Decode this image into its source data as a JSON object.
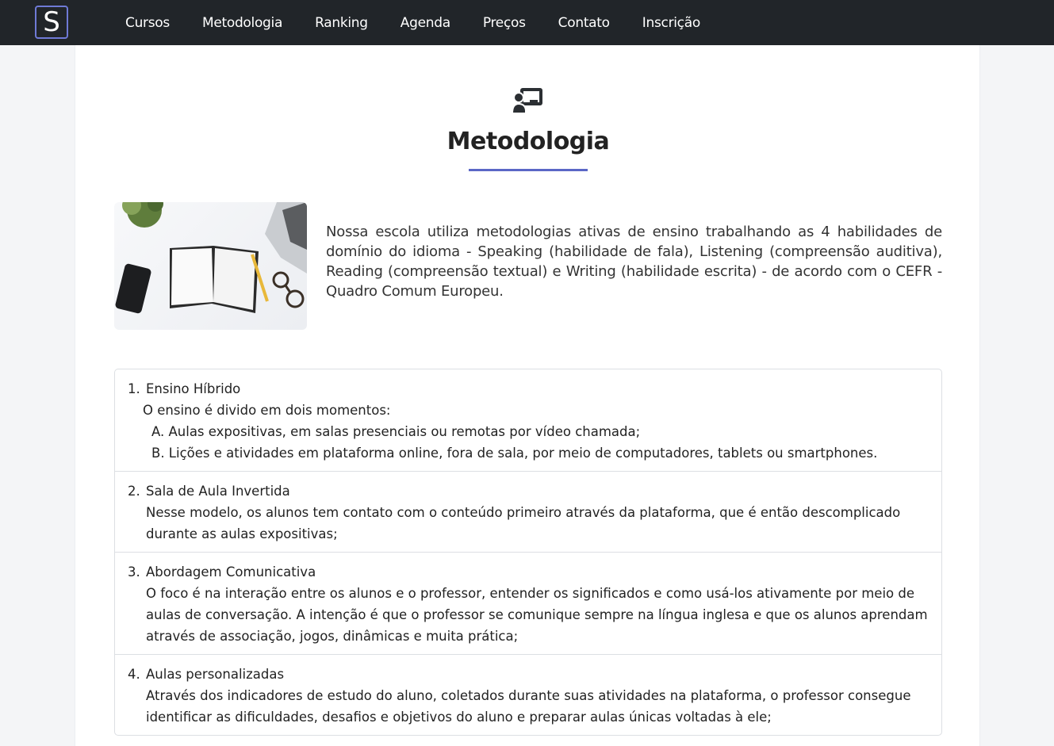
{
  "nav": {
    "logo": "S",
    "links": [
      "Cursos",
      "Metodologia",
      "Ranking",
      "Agenda",
      "Preços",
      "Contato",
      "Inscrição"
    ]
  },
  "header": {
    "icon": "chalkboard-teacher-icon",
    "title": "Metodologia"
  },
  "intro": {
    "image": "desk-with-notebook-phone-laptop-photo",
    "segments": [
      {
        "text": "Nossa escola utiliza metodologias ativas de ensino trabalhando as 4 habilidades de domínio do idioma - "
      },
      {
        "text": "Speaking"
      },
      {
        "text": " (habilidade de fala), "
      },
      {
        "text": "Listening"
      },
      {
        "text": " (compreensão auditiva), "
      },
      {
        "text": "Reading"
      },
      {
        "text": " (compreensão textual) e "
      },
      {
        "text": "Writing"
      },
      {
        "text": " (habilidade escrita) - de acordo com o CEFR - Quadro Comum Europeu."
      }
    ]
  },
  "methods": [
    {
      "number": "1.",
      "title": "Ensino Híbrido",
      "description": "O ensino é divido em dois momentos:",
      "sub_items": [
        "A. Aulas expositivas, em salas presenciais ou remotas por vídeo chamada;",
        "B. Lições e atividades em plataforma online, fora de sala, por meio de computadores, tablets ou smartphones."
      ]
    },
    {
      "number": "2.",
      "title": "Sala de Aula Invertida",
      "description": "Nesse modelo, os alunos tem contato com o conteúdo primeiro através da plataforma, que é então descomplicado durante as aulas expositivas;"
    },
    {
      "number": "3.",
      "title": "Abordagem Comunicativa",
      "description": "O foco é na interação entre os alunos e o professor, entender os significados e como usá-los ativamente por meio de aulas de conversação. A intenção é que o professor se comunique sempre na língua inglesa e que os alunos aprendam através de associação, jogos, dinâmicas e muita prática;"
    },
    {
      "number": "4.",
      "title": "Aulas personalizadas",
      "description": "Através dos indicadores de estudo do aluno, coletados durante suas atividades na plataforma, o professor consegue identificar as dificuldades, desafios e objetivos do aluno e preparar aulas únicas voltadas à ele;"
    }
  ],
  "colors": {
    "navbar": "#212529",
    "accent": "#5b67c6",
    "logo_border": "#6f7ad6"
  }
}
